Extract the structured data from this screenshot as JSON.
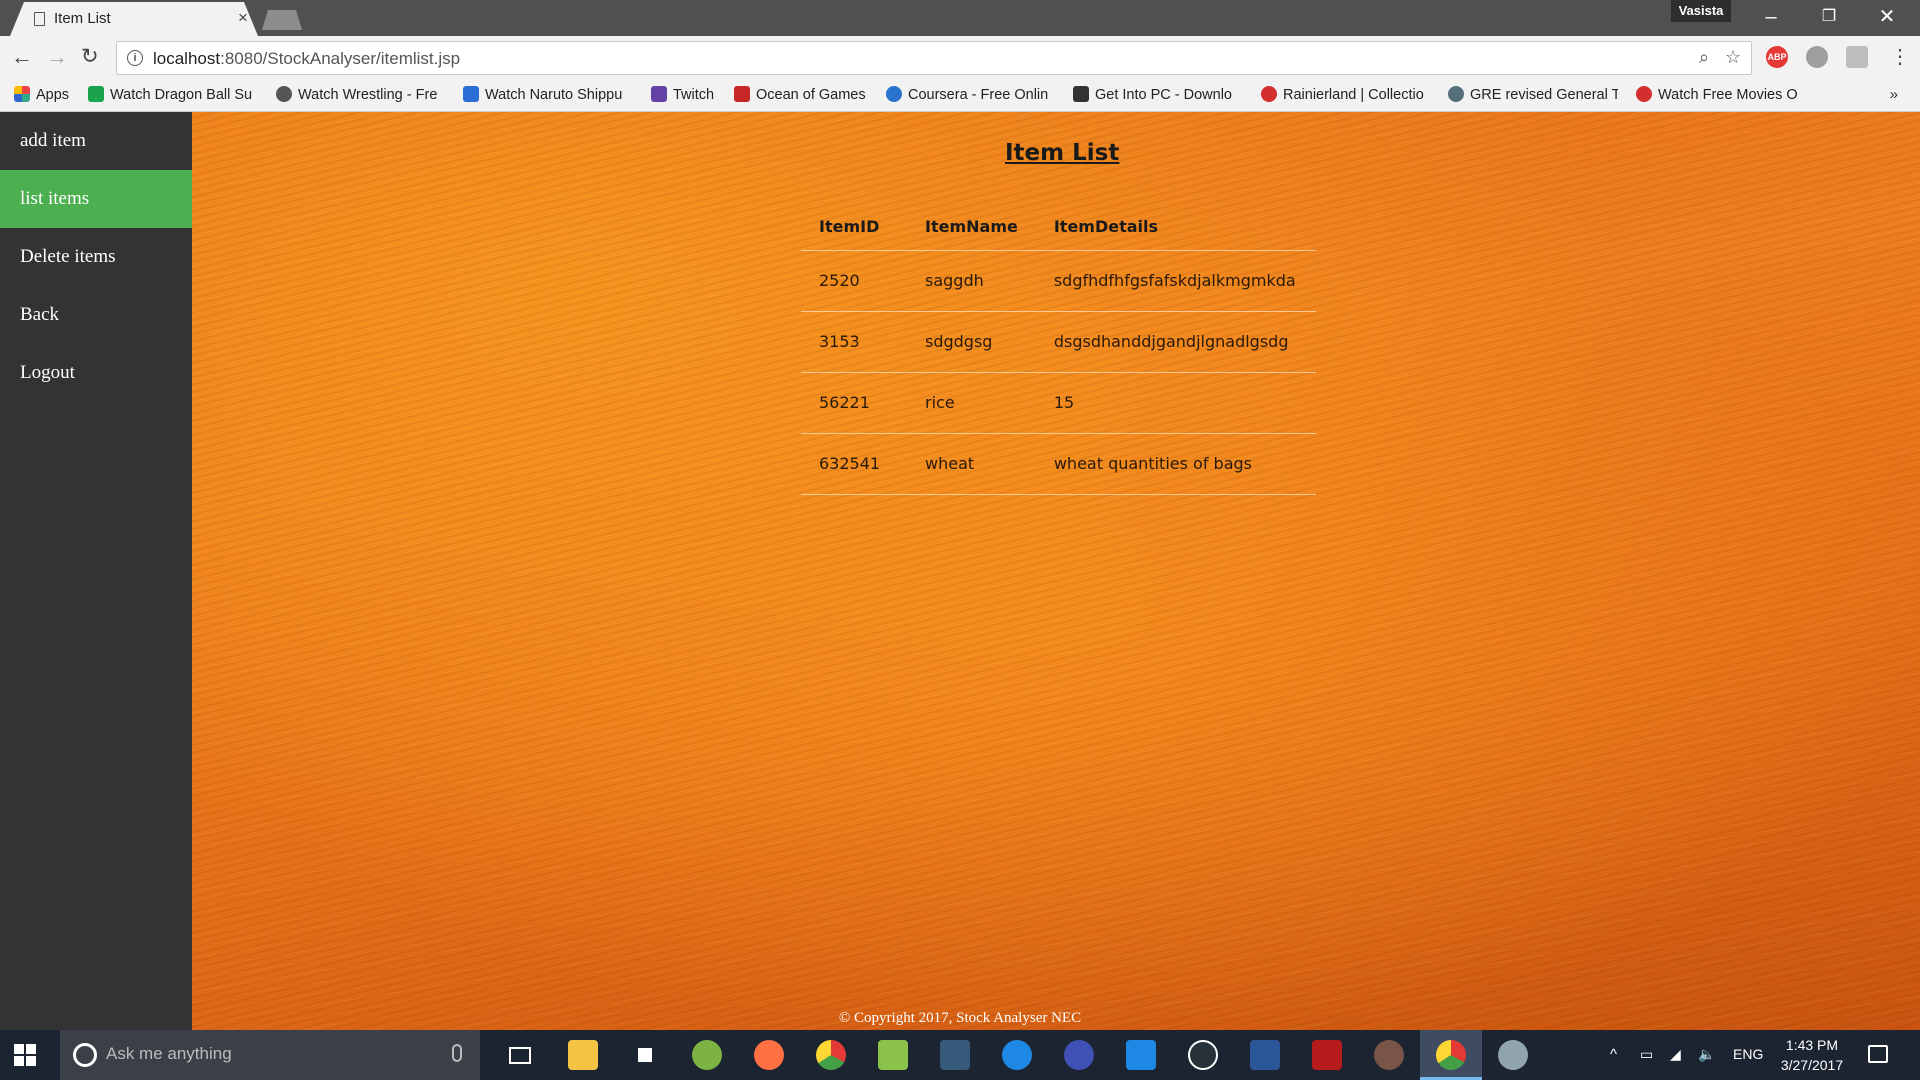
{
  "browser": {
    "tab_title": "Item List",
    "profile_name": "Vasista",
    "url_host": "localhost",
    "url_path": ":8080/StockAnalyser/itemlist.jsp",
    "bookmarks": [
      {
        "label": "Apps",
        "color": "#e44"
      },
      {
        "label": "Watch Dragon Ball Su",
        "color": "#1aa34a"
      },
      {
        "label": "Watch Wrestling - Fre",
        "color": "#555"
      },
      {
        "label": "Watch Naruto Shippu",
        "color": "#2b6fd6"
      },
      {
        "label": "Twitch",
        "color": "#6441a4"
      },
      {
        "label": "Ocean of Games",
        "color": "#c62828"
      },
      {
        "label": "Coursera - Free Onlin",
        "color": "#2a73cc"
      },
      {
        "label": "Get Into PC - Downlo",
        "color": "#333"
      },
      {
        "label": "Rainierland | Collectio",
        "color": "#d32f2f"
      },
      {
        "label": "GRE revised General T",
        "color": "#546e7a"
      },
      {
        "label": "Watch Free Movies O",
        "color": "#d32f2f"
      }
    ]
  },
  "sidebar": {
    "items": [
      {
        "label": "add item",
        "active": false
      },
      {
        "label": "list items",
        "active": true
      },
      {
        "label": "Delete items",
        "active": false
      },
      {
        "label": "Back",
        "active": false
      },
      {
        "label": "Logout",
        "active": false
      }
    ]
  },
  "main": {
    "heading": "Item List",
    "table": {
      "headers": [
        "ItemID",
        "ItemName",
        "ItemDetails"
      ],
      "rows": [
        [
          "2520",
          "saggdh",
          "sdgfhdfhfgsfafskdjalkmgmkda"
        ],
        [
          "3153",
          "sdgdgsg",
          "dsgsdhanddjgandjlgnadlgsdg"
        ],
        [
          "56221",
          "rice",
          "15"
        ],
        [
          "632541",
          "wheat",
          "wheat quantities of bags"
        ]
      ]
    },
    "footer": "© Copyright 2017, Stock Analyser NEC"
  },
  "taskbar": {
    "search_placeholder": "Ask me anything",
    "language": "ENG",
    "time": "1:43 PM",
    "date": "3/27/2017"
  },
  "colors": {
    "sidebar_bg": "#333333",
    "active_item": "#4caf50",
    "page_bg": "#f07d1f"
  }
}
